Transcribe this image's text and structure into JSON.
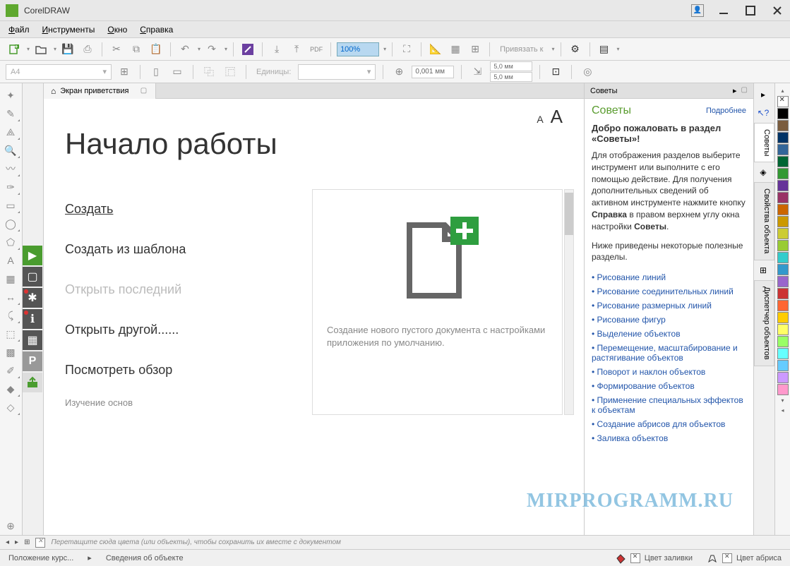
{
  "app": {
    "title": "CorelDRAW"
  },
  "menu": {
    "file": "Файл",
    "tools": "Инструменты",
    "window": "Окно",
    "help": "Справка"
  },
  "toolbar": {
    "zoom": "100%",
    "snap_label": "Привязать к"
  },
  "propbar": {
    "page_size": "A4",
    "units_label": "Единицы:",
    "nudge": "0,001 мм",
    "dup_x": "5,0 мм",
    "dup_y": "5,0 мм"
  },
  "tab": {
    "welcome": "Экран приветствия"
  },
  "welcome": {
    "title": "Начало работы",
    "items": {
      "create": "Создать",
      "from_template": "Создать из шаблона",
      "open_recent": "Открыть последний",
      "open_other": "Открыть другой......",
      "watch_tour": "Посмотреть обзор",
      "learn_basics": "Изучение основ"
    },
    "preview_desc": "Создание нового пустого документа с настройками приложения по умолчанию."
  },
  "hints": {
    "panel_tab": "Советы",
    "title": "Советы",
    "more": "Подробнее",
    "welcome_h": "Добро пожаловать в раздел «Советы»!",
    "p1a": "Для отображения разделов выберите инструмент или выполните с его помощью действие. Для получения дополнительных сведений об активном инструменте нажмите кнопку ",
    "p1b": "Справка",
    "p1c": " в правом верхнем углу окна настройки ",
    "p1d": "Советы",
    "p2": "Ниже приведены некоторые полезные разделы.",
    "links": [
      "Рисование линий",
      "Рисование соединительных линий",
      "Рисование размерных линий",
      "Рисование фигур",
      "Выделение объектов",
      "Перемещение, масштабирование и растягивание объектов",
      "Поворот и наклон объектов",
      "Формирование объектов",
      "Применение специальных эффектов к объектам",
      "Создание абрисов для объектов",
      "Заливка объектов"
    ]
  },
  "dock": {
    "hints": "Советы",
    "obj_props": "Свойства объекта",
    "obj_mgr": "Диспетчер объектов"
  },
  "colorbar": {
    "hint": "Перетащите сюда цвета (или объекты), чтобы сохранить их вместе с документом"
  },
  "status": {
    "cursor_pos": "Положение курс...",
    "obj_info": "Сведения об объекте",
    "fill": "Цвет заливки",
    "outline": "Цвет абриса"
  },
  "watermark": "MIRPROGRAMM.RU",
  "palette": [
    "#000000",
    "#7a5c3e",
    "#003366",
    "#336699",
    "#006633",
    "#339933",
    "#663399",
    "#993366",
    "#cc6600",
    "#cc9900",
    "#cccc33",
    "#99cc33",
    "#33cccc",
    "#3399cc",
    "#9966cc",
    "#cc3333",
    "#ff6633",
    "#ffcc00",
    "#ffff66",
    "#99ff66",
    "#66ffff",
    "#66ccff",
    "#cc99ff",
    "#ff99cc",
    "#ff9999"
  ]
}
